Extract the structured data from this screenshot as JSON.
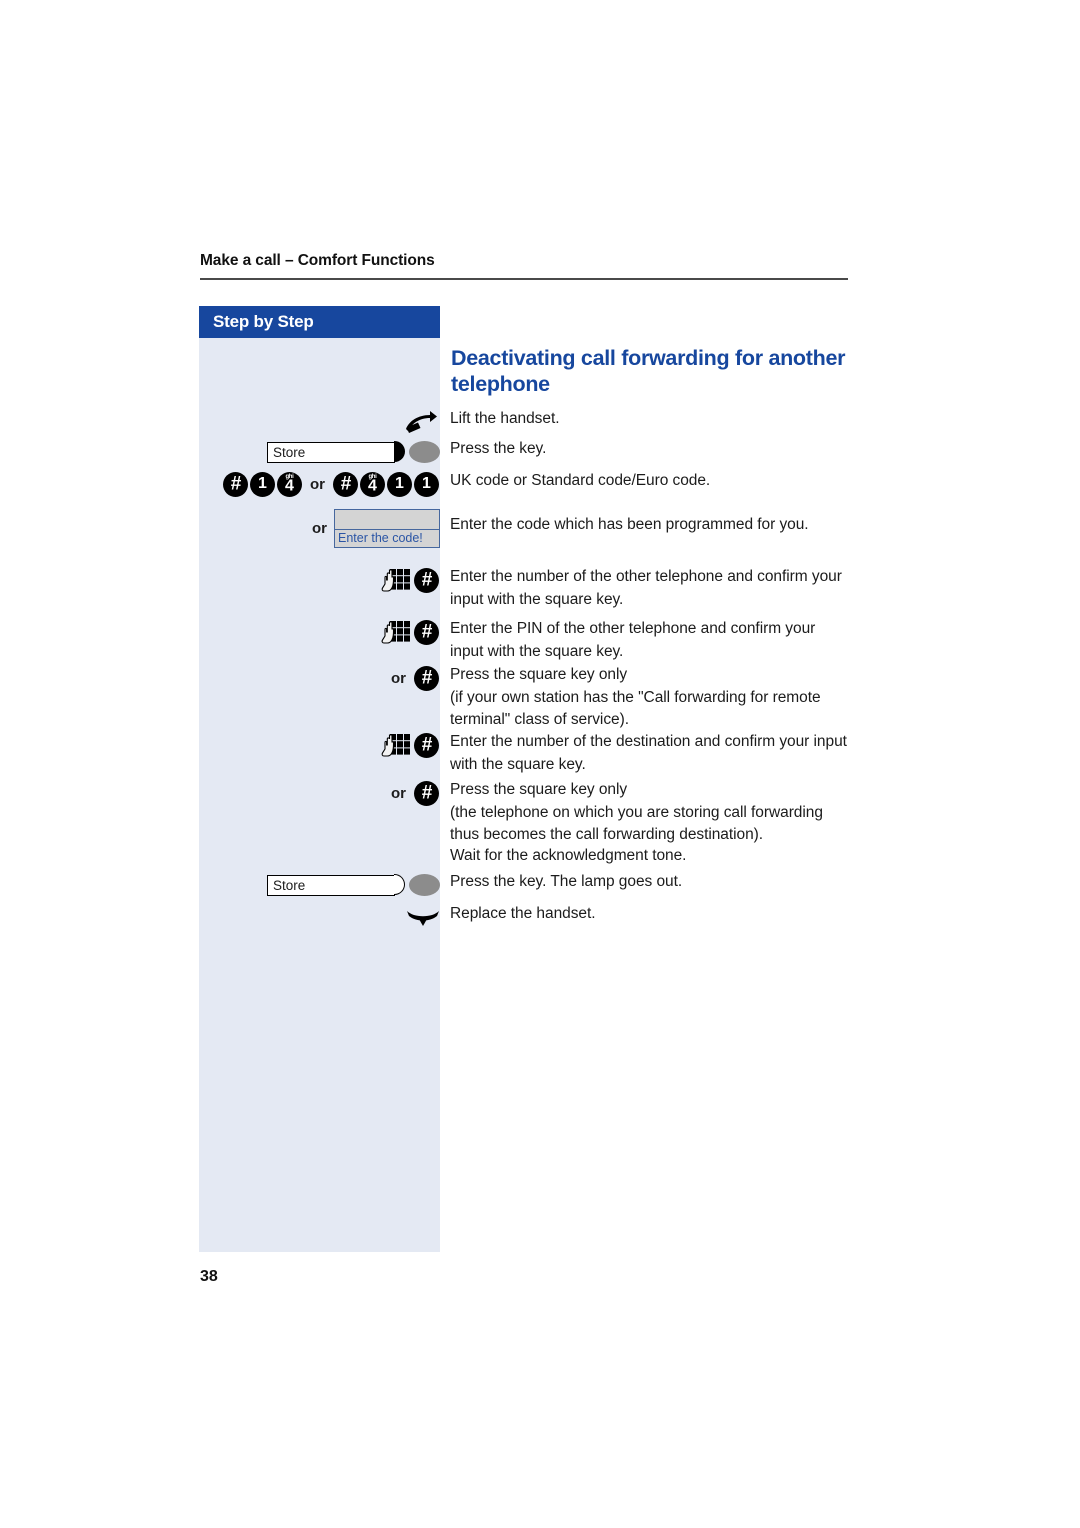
{
  "document": {
    "running_header": "Make a call – Comfort Functions",
    "page_number": "38"
  },
  "sidebar": {
    "title": "Step by Step",
    "background_color": "#e4e9f3",
    "title_bar_color": "#17479e"
  },
  "heading": {
    "text": "Deactivating call forwarding for another telephone",
    "color": "#17479e"
  },
  "steps": [
    {
      "icons": [
        {
          "type": "handset-lift"
        }
      ],
      "text": "Lift the handset."
    },
    {
      "icons": [
        {
          "type": "function-key",
          "label": "Store",
          "lamp": "on"
        }
      ],
      "text": "Press the key."
    },
    {
      "icons": [
        {
          "type": "keypad-key",
          "glyph": "#"
        },
        {
          "type": "keypad-key",
          "glyph": "1"
        },
        {
          "type": "keypad-key",
          "glyph": "4",
          "sub": "ghi"
        },
        {
          "type": "or-label",
          "label": "or"
        },
        {
          "type": "keypad-key",
          "glyph": "#"
        },
        {
          "type": "keypad-key",
          "glyph": "4",
          "sub": "ghi"
        },
        {
          "type": "keypad-key",
          "glyph": "1"
        },
        {
          "type": "keypad-key",
          "glyph": "1"
        }
      ],
      "text": "UK code or Standard code/Euro code."
    },
    {
      "icons": [
        {
          "type": "or-label",
          "label": "or"
        },
        {
          "type": "display-field",
          "prompt": "Enter the code!"
        }
      ],
      "text": "Enter the code which has been programmed for you."
    },
    {
      "icons": [
        {
          "type": "hand-keypad"
        },
        {
          "type": "keypad-key",
          "glyph": "#"
        }
      ],
      "text": "Enter the number of the other telephone and confirm your input with the square key."
    },
    {
      "icons": [
        {
          "type": "hand-keypad"
        },
        {
          "type": "keypad-key",
          "glyph": "#"
        }
      ],
      "text": "Enter the PIN of the other telephone and confirm your input with the square key."
    },
    {
      "icons": [
        {
          "type": "or-label",
          "label": "or"
        },
        {
          "type": "keypad-key",
          "glyph": "#"
        }
      ],
      "text": "Press the square key only\n(if your own station has the \"Call forwarding for remote terminal\" class of service)."
    },
    {
      "icons": [
        {
          "type": "hand-keypad"
        },
        {
          "type": "keypad-key",
          "glyph": "#"
        }
      ],
      "text": "Enter the number of the destination and confirm your input with the square key."
    },
    {
      "icons": [
        {
          "type": "or-label",
          "label": "or"
        },
        {
          "type": "keypad-key",
          "glyph": "#"
        }
      ],
      "text": "Press the square key only\n(the telephone on which you are storing call forwarding thus becomes the call forwarding destination)."
    },
    {
      "icons": [],
      "text": "Wait for the acknowledgment tone."
    },
    {
      "icons": [
        {
          "type": "function-key",
          "label": "Store",
          "lamp": "off"
        }
      ],
      "text": "Press the key. The lamp goes out."
    },
    {
      "icons": [
        {
          "type": "handset-replace"
        }
      ],
      "text": "Replace the handset."
    }
  ]
}
